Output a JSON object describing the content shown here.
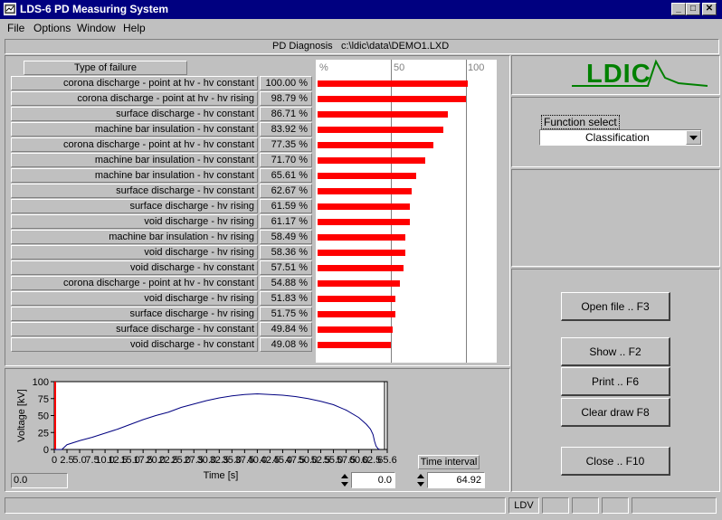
{
  "window": {
    "title": "LDS-6  PD Measuring System"
  },
  "menu": [
    "File",
    "Options",
    "Window",
    "Help"
  ],
  "diagnosis": {
    "label": "PD Diagnosis",
    "path": "c:\\ldic\\data\\DEMO1.LXD"
  },
  "table": {
    "header": "Type of failure",
    "scale_labels": [
      "%",
      "50",
      "100"
    ],
    "rows": [
      {
        "label": "corona discharge - point at hv - hv constant",
        "value": "100.00 %",
        "pct": 100.0
      },
      {
        "label": "corona discharge - point at hv - hv rising",
        "value": "98.79 %",
        "pct": 98.79
      },
      {
        "label": "surface discharge - hv constant",
        "value": "86.71 %",
        "pct": 86.71
      },
      {
        "label": "machine bar insulation - hv constant",
        "value": "83.92 %",
        "pct": 83.92
      },
      {
        "label": "corona discharge - point at hv - hv constant",
        "value": "77.35 %",
        "pct": 77.35
      },
      {
        "label": "machine bar insulation - hv constant",
        "value": "71.70 %",
        "pct": 71.7
      },
      {
        "label": "machine bar insulation - hv constant",
        "value": "65.61 %",
        "pct": 65.61
      },
      {
        "label": "surface discharge - hv constant",
        "value": "62.67 %",
        "pct": 62.67
      },
      {
        "label": "surface discharge - hv rising",
        "value": "61.59 %",
        "pct": 61.59
      },
      {
        "label": "void discharge - hv rising",
        "value": "61.17 %",
        "pct": 61.17
      },
      {
        "label": "machine bar insulation - hv rising",
        "value": "58.49 %",
        "pct": 58.49
      },
      {
        "label": "void discharge - hv rising",
        "value": "58.36 %",
        "pct": 58.36
      },
      {
        "label": "void discharge - hv constant",
        "value": "57.51 %",
        "pct": 57.51
      },
      {
        "label": "corona discharge - point at hv - hv constant",
        "value": "54.88 %",
        "pct": 54.88
      },
      {
        "label": "void discharge - hv rising",
        "value": "51.83 %",
        "pct": 51.83
      },
      {
        "label": "surface discharge - hv rising",
        "value": "51.75 %",
        "pct": 51.75
      },
      {
        "label": "surface discharge - hv constant",
        "value": "49.84 %",
        "pct": 49.84
      },
      {
        "label": "void discharge - hv constant",
        "value": "49.08 %",
        "pct": 49.08
      }
    ]
  },
  "logo": {
    "text": "LDIC"
  },
  "function_select": {
    "label": "Function select",
    "value": "Classification"
  },
  "buttons": {
    "open": "Open file .. F3",
    "show": "Show .. F2",
    "print": "Print .. F6",
    "clear": "Clear draw  F8",
    "close": "Close .. F10"
  },
  "chart_data": {
    "type": "line",
    "xlabel": "Time [s]",
    "ylabel": "Voltage [kV]",
    "xlim": [
      0,
      65.6
    ],
    "ylim": [
      0,
      100
    ],
    "xticks": [
      "0",
      "2.5",
      "5.0",
      "7.5",
      "10.0",
      "12.5",
      "15.0",
      "17.5",
      "20.0",
      "22.5",
      "25.0",
      "27.5",
      "30.0",
      "32.5",
      "35.0",
      "37.5",
      "40.0",
      "42.5",
      "45.0",
      "47.5",
      "50.0",
      "52.5",
      "55.0",
      "57.5",
      "60.0",
      "62.5",
      "65.6"
    ],
    "xtick_values": [
      0,
      2.5,
      5,
      7.5,
      10,
      12.5,
      15,
      17.5,
      20,
      22.5,
      25,
      27.5,
      30,
      32.5,
      35,
      37.5,
      40,
      42.5,
      45,
      47.5,
      50,
      52.5,
      55,
      57.5,
      60,
      62.5,
      65.6
    ],
    "yticks": [
      "0",
      "25",
      "50",
      "75",
      "100"
    ],
    "ytick_values": [
      0,
      25,
      50,
      75,
      100
    ],
    "x": [
      0,
      1,
      1.5,
      2.5,
      5,
      7.5,
      10,
      12.5,
      15,
      17.5,
      20,
      22.5,
      25,
      27.5,
      30,
      32.5,
      35,
      37.5,
      40,
      42.5,
      45,
      47.5,
      50,
      52.5,
      55,
      57.5,
      60,
      61.5,
      62.3,
      62.8,
      63.1,
      63.4,
      63.8,
      64.1
    ],
    "y": [
      0,
      0,
      0,
      7,
      13,
      18,
      24,
      30,
      37,
      44,
      50,
      55,
      62,
      67,
      72,
      76,
      79,
      81,
      82,
      81,
      80,
      78,
      75,
      71,
      66,
      58,
      47,
      37,
      30,
      22,
      12,
      5,
      1,
      0
    ],
    "color": "#000080"
  },
  "chart_panel": {
    "left_readout": "0.0"
  },
  "time": {
    "start": "0.0",
    "interval_label": "Time interval",
    "interval": "64.92"
  },
  "status": {
    "ldv": "LDV"
  },
  "colors": {
    "bar": "#ff0000",
    "title_bg": "#000080",
    "logo": "#008000"
  }
}
